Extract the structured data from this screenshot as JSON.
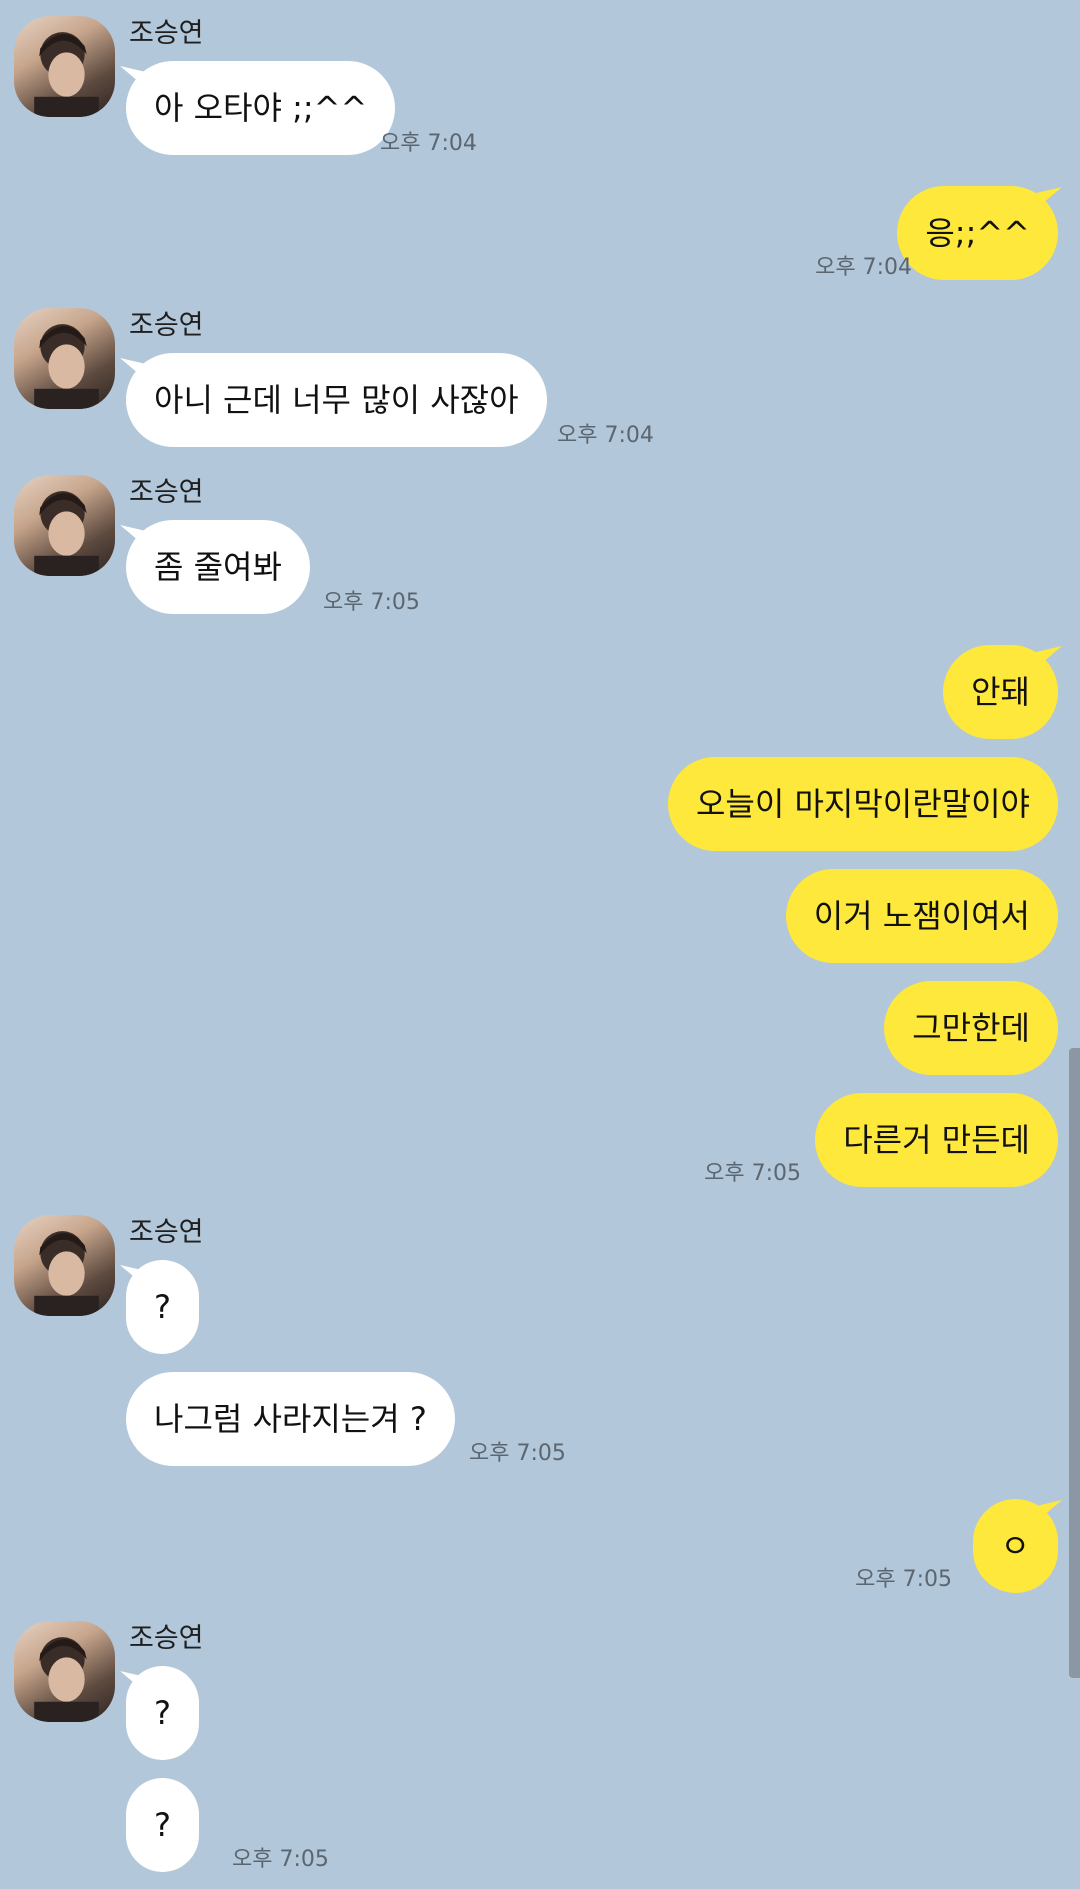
{
  "contact": {
    "name": "조승연",
    "avatar_icon": "profile-photo-icon"
  },
  "colors": {
    "background": "#b2c7d9",
    "incoming_bubble": "#ffffff",
    "outgoing_bubble": "#fee83c",
    "timestamp": "#5b6670"
  },
  "messages": [
    {
      "sender": "조승연",
      "text": "아 오타야 ;;^^",
      "time": "오후 7:04"
    },
    {
      "text": "응;;^^",
      "time": "오후 7:04"
    },
    {
      "sender": "조승연",
      "text": "아니 근데 너무 많이 사잖아",
      "time": "오후 7:04"
    },
    {
      "sender": "조승연",
      "text": "좀 줄여봐",
      "time": "오후 7:05"
    },
    {
      "text": "안돼"
    },
    {
      "text": "오늘이 마지막이란말이야"
    },
    {
      "text": "이거 노잼이여서"
    },
    {
      "text": "그만한데"
    },
    {
      "text": "다른거 만든데",
      "time": "오후 7:05"
    },
    {
      "sender": "조승연",
      "text": "?"
    },
    {
      "text": "나그럼 사라지는겨 ?",
      "time": "오후 7:05"
    },
    {
      "text": "ㅇ",
      "time": "오후 7:05"
    },
    {
      "sender": "조승연",
      "text": "?"
    },
    {
      "text": "?",
      "time": "오후 7:05"
    }
  ]
}
